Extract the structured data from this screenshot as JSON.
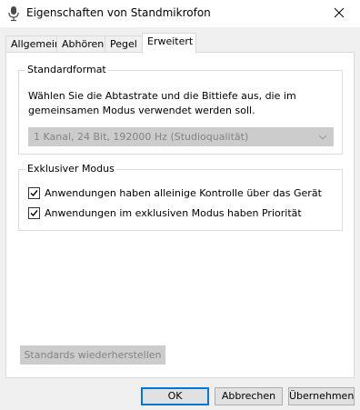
{
  "window": {
    "title": "Eigenschaften von Standmikrofon",
    "icon": "microphone-icon",
    "close_icon": "close-icon"
  },
  "tabs": [
    {
      "label": "Allgemein",
      "active": false
    },
    {
      "label": "Abhören",
      "active": false
    },
    {
      "label": "Pegel",
      "active": false
    },
    {
      "label": "Erweitert",
      "active": true
    }
  ],
  "standardformat": {
    "legend": "Standardformat",
    "description": "Wählen Sie die Abtastrate und die Bittiefe aus, die im gemeinsamen Modus verwendet werden soll.",
    "selected": "1 Kanal, 24 Bit, 192000 Hz (Studioqualität)",
    "disabled": true
  },
  "exclusive": {
    "legend": "Exklusiver Modus",
    "options": [
      {
        "label": "Anwendungen haben alleinige Kontrolle über das Gerät",
        "checked": true
      },
      {
        "label": "Anwendungen im exklusiven Modus haben Priorität",
        "checked": true
      }
    ]
  },
  "reset_button": {
    "label": "Standards wiederherstellen",
    "disabled": true
  },
  "footer": {
    "ok": "OK",
    "cancel": "Abbrechen",
    "apply": "Übernehmen"
  },
  "colors": {
    "accent": "#0078d7",
    "disabled_bg": "#cccccc",
    "disabled_text": "#838383"
  }
}
